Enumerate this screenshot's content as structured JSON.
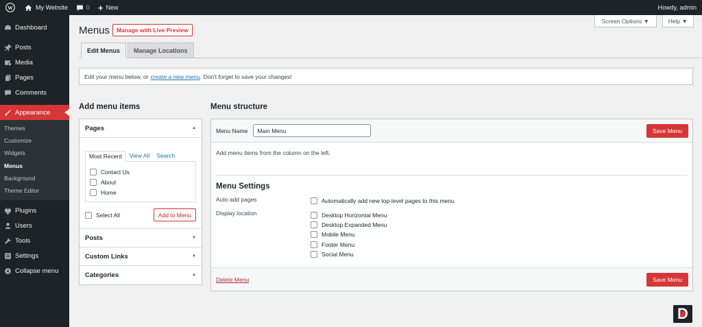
{
  "adminbar": {
    "site_name": "My Website",
    "comments_count": "0",
    "new_label": "New",
    "howdy": "Howdy, admin"
  },
  "sidebar": {
    "items": [
      {
        "label": "Dashboard",
        "icon": "dashboard-icon"
      },
      {
        "label": "Posts",
        "icon": "pin-icon"
      },
      {
        "label": "Media",
        "icon": "media-icon"
      },
      {
        "label": "Pages",
        "icon": "pages-icon"
      },
      {
        "label": "Comments",
        "icon": "comment-icon"
      },
      {
        "label": "Appearance",
        "icon": "brush-icon",
        "active": true
      },
      {
        "label": "Plugins",
        "icon": "plugin-icon"
      },
      {
        "label": "Users",
        "icon": "user-icon"
      },
      {
        "label": "Tools",
        "icon": "wrench-icon"
      },
      {
        "label": "Settings",
        "icon": "settings-icon"
      },
      {
        "label": "Collapse menu",
        "icon": "collapse-icon"
      }
    ],
    "submenu": [
      "Themes",
      "Customize",
      "Widgets",
      "Menus",
      "Background",
      "Theme Editor"
    ],
    "submenu_current": "Menus"
  },
  "screen_options": "Screen Options ▼",
  "help": "Help ▼",
  "page": {
    "title": "Menus",
    "live_preview": "Manage with Live Preview",
    "tabs": [
      "Edit Menus",
      "Manage Locations"
    ]
  },
  "notice": {
    "before": "Edit your menu below, or",
    "link": "create a new menu",
    "after": ". Don't forget to save your changes!"
  },
  "add_items": {
    "title": "Add menu items",
    "pages_label": "Pages",
    "mini_tabs": [
      "Most Recent",
      "View All",
      "Search"
    ],
    "pages": [
      "Contact Us",
      "About",
      "Home"
    ],
    "select_all": "Select All",
    "add_button": "Add to Menu",
    "sections": [
      "Posts",
      "Custom Links",
      "Categories"
    ]
  },
  "structure": {
    "title": "Menu structure",
    "name_label": "Menu Name",
    "name_value": "Main Menu",
    "save_label": "Save Menu",
    "instructions": "Add menu items from the column on the left.",
    "settings_title": "Menu Settings",
    "auto_add_label": "Auto add pages",
    "auto_add_option": "Automatically add new top-level pages to this menu",
    "display_label": "Display location",
    "locations": [
      "Desktop Horizontal Menu",
      "Desktop Expanded Menu",
      "Mobile Menu",
      "Footer Menu",
      "Social Menu"
    ],
    "delete_label": "Delete Menu"
  },
  "colors": {
    "accent": "#d63638",
    "sidebar_bg": "#1d2327",
    "link": "#2271b1"
  }
}
